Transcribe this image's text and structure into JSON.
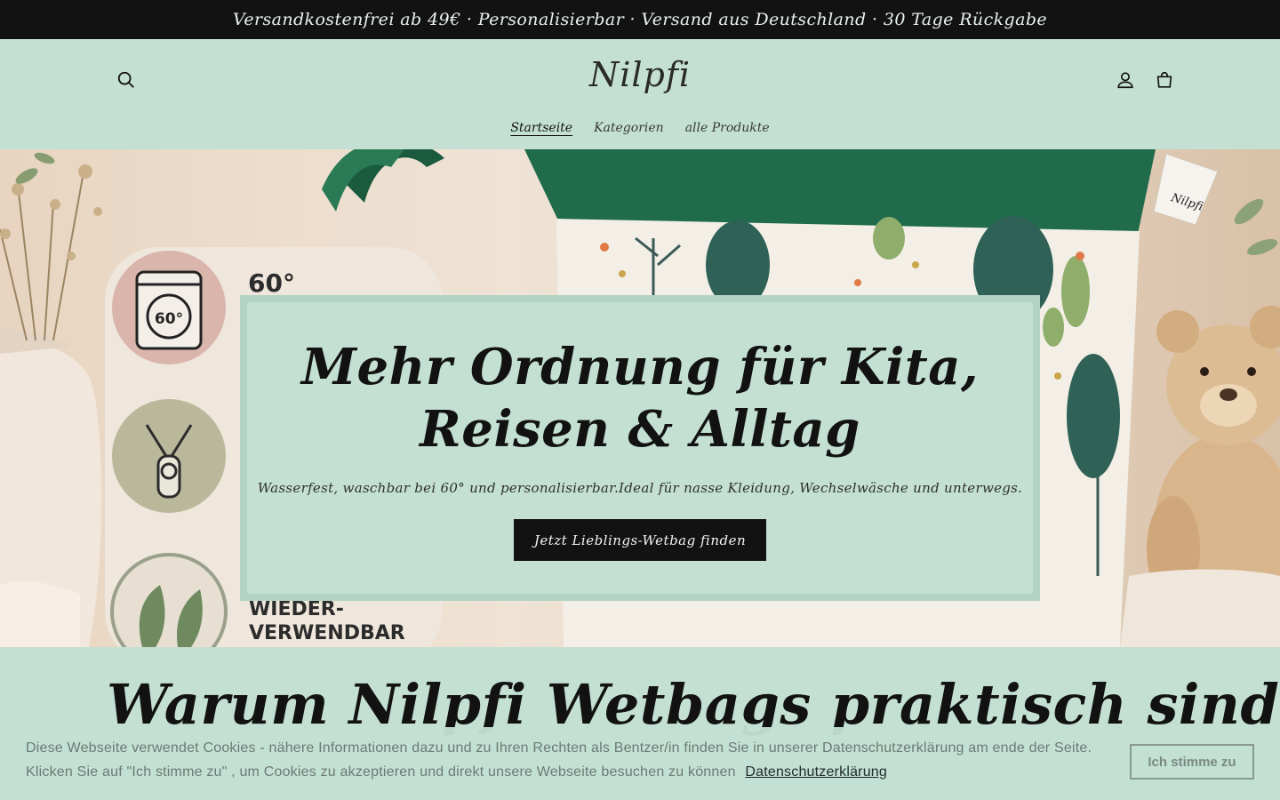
{
  "announcement": "Versandkostenfrei ab 49€ · Personalisierbar · Versand aus Deutschland · 30 Tage Rückgabe",
  "header": {
    "logo": "Nilpfi",
    "icons": {
      "search": "search-icon",
      "account": "account-icon",
      "cart": "cart-icon"
    },
    "nav": [
      {
        "label": "Startseite",
        "active": true
      },
      {
        "label": "Kategorien",
        "active": false
      },
      {
        "label": "alle Produkte",
        "active": false
      }
    ]
  },
  "hero": {
    "title": "Mehr Ordnung für Kita, Reisen & Alltag",
    "subtitle": "Wasserfest, waschbar bei 60° und personalisierbar.Ideal für nasse Kleidung, Wechselwäsche und unterwegs.",
    "cta": "Jetzt Lieblings-Wetbag finden",
    "image_labels": {
      "temp": "60°",
      "temp_badge": "60°",
      "reusable": "WIEDER- VERWENDBAR",
      "tag": "Nilpfi"
    }
  },
  "section": {
    "heading": "Warum Nilpfi Wetbags praktisch sind?"
  },
  "cookie": {
    "text": "Diese Webseite verwendet Cookies - nähere Informationen dazu und zu Ihren Rechten als Bentzer/in finden Sie in unserer Datenschutzerklärung am ende der Seite. Klicken Sie auf \"Ich stimme zu\" , um Cookies zu akzeptieren und direkt unsere Webseite besuchen zu können",
    "link": "Datenschutzerklärung",
    "accept": "Ich stimme zu"
  },
  "colors": {
    "background": "#c3e0d3",
    "announcement_bg": "#121212",
    "button_bg": "#121212",
    "card_border": "#b3d3c4",
    "bag_green": "#1f6b4c"
  }
}
